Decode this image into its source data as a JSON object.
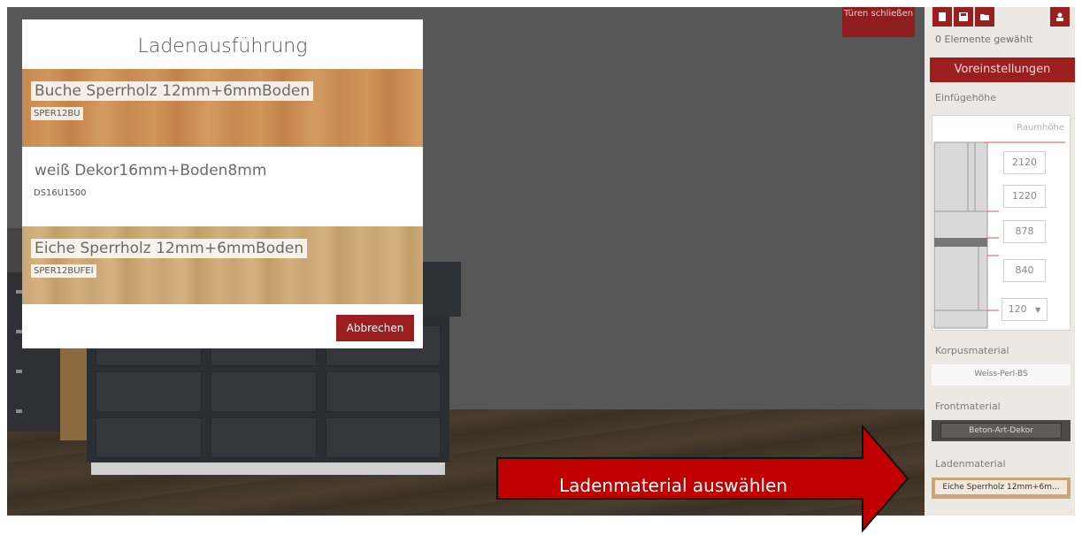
{
  "toolbar": {
    "doors_label": "Türen schließen",
    "selection_count": "0 Elemente gewählt",
    "presets_label": "Voreinstellungen"
  },
  "insert_height": {
    "label": "Einfügehöhe",
    "room_height_label": "Raumhöhe",
    "values": [
      "2120",
      "1220",
      "878",
      "840",
      "120"
    ]
  },
  "materials": {
    "body_label": "Korpusmaterial",
    "body_value": "Weiss-Perl-BS",
    "front_label": "Frontmaterial",
    "front_value": "Beton-Art-Dekor",
    "drawer_label": "Ladenmaterial",
    "drawer_value": "Eiche Sperrholz 12mm+6m..."
  },
  "modal": {
    "title": "Ladenausführung",
    "options": [
      {
        "name": "Buche Sperrholz 12mm+6mmBoden",
        "code": "SPER12BU"
      },
      {
        "name": "weiß Dekor16mm+Boden8mm",
        "code": "DS16U1500"
      },
      {
        "name": "Eiche Sperrholz 12mm+6mmBoden",
        "code": "SPER12BUFEI"
      }
    ],
    "cancel_label": "Abbrechen"
  },
  "annotation": {
    "text": "Ladenmaterial auswählen"
  },
  "colors": {
    "accent": "#9b1f1f",
    "annotation_arrow": "#c00000"
  }
}
